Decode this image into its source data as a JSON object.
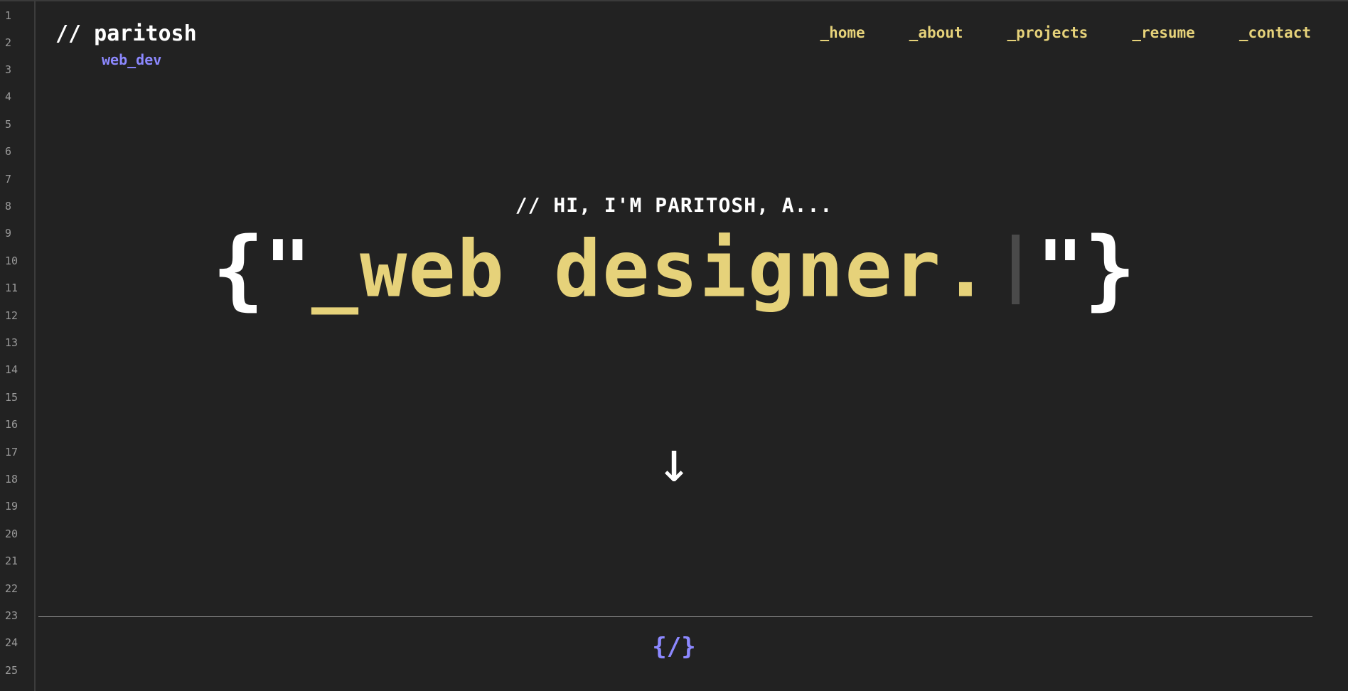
{
  "gutter": {
    "line_numbers": [
      "1",
      "2",
      "3",
      "4",
      "5",
      "6",
      "7",
      "8",
      "9",
      "10",
      "11",
      "12",
      "13",
      "14",
      "15",
      "16",
      "17",
      "18",
      "19",
      "20",
      "21",
      "22",
      "23",
      "24",
      "25"
    ]
  },
  "brand": {
    "name": "// paritosh",
    "subtitle": "web_dev"
  },
  "nav": {
    "items": [
      {
        "label": "_home"
      },
      {
        "label": "_about"
      },
      {
        "label": "_projects"
      },
      {
        "label": "_resume"
      },
      {
        "label": "_contact"
      }
    ]
  },
  "hero": {
    "greeting": "// HI, I'M PARITOSH, A...",
    "open_brace": "{",
    "open_quote": "\"",
    "typed_text": "_web designer.",
    "close_quote": "\"",
    "close_brace": "}"
  },
  "scroll": {
    "arrow_glyph": "↓",
    "icon": "arrow-down-icon"
  },
  "footer": {
    "code_glyph": "{/}",
    "icon": "code-icon"
  },
  "colors": {
    "background": "#222222",
    "accent_yellow": "#e6d27a",
    "accent_purple": "#8c88ff",
    "text": "#ffffff",
    "gutter_text": "#9a9a9a"
  }
}
